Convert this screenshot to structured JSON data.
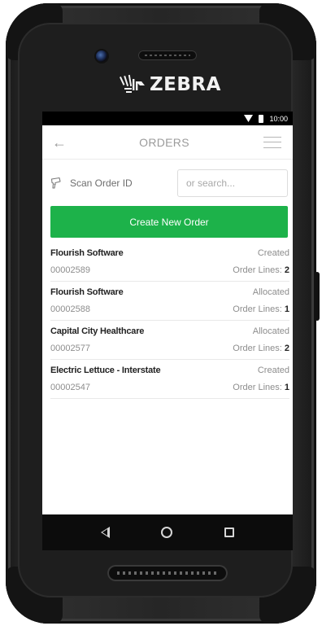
{
  "device": {
    "brand": "ZEBRA"
  },
  "status_bar": {
    "time": "10:00",
    "icons": [
      "wifi-icon",
      "battery-icon"
    ]
  },
  "header": {
    "title": "ORDERS",
    "back_icon": "arrow-left-icon",
    "menu_icon": "hamburger-menu-icon"
  },
  "search": {
    "scan_label": "Scan Order ID",
    "scan_icon": "barcode-scanner-icon",
    "placeholder": "or search...",
    "value": ""
  },
  "actions": {
    "create_label": "Create New Order"
  },
  "orders": [
    {
      "customer": "Flourish Software",
      "status": "Created",
      "id": "00002589",
      "lines_label": "Order Lines:",
      "lines": "2"
    },
    {
      "customer": "Flourish Software",
      "status": "Allocated",
      "id": "00002588",
      "lines_label": "Order Lines:",
      "lines": "1"
    },
    {
      "customer": "Capital City Healthcare",
      "status": "Allocated",
      "id": "00002577",
      "lines_label": "Order Lines:",
      "lines": "2"
    },
    {
      "customer": "Electric Lettuce - Interstate",
      "status": "Created",
      "id": "00002547",
      "lines_label": "Order Lines:",
      "lines": "1"
    }
  ],
  "nav": {
    "icons": [
      "back-triangle-icon",
      "home-circle-icon",
      "recents-square-icon"
    ]
  },
  "colors": {
    "accent": "#1db24a",
    "status_bar": "#000000",
    "nav_bar": "#0c0c0c",
    "device_body": "#262626"
  }
}
